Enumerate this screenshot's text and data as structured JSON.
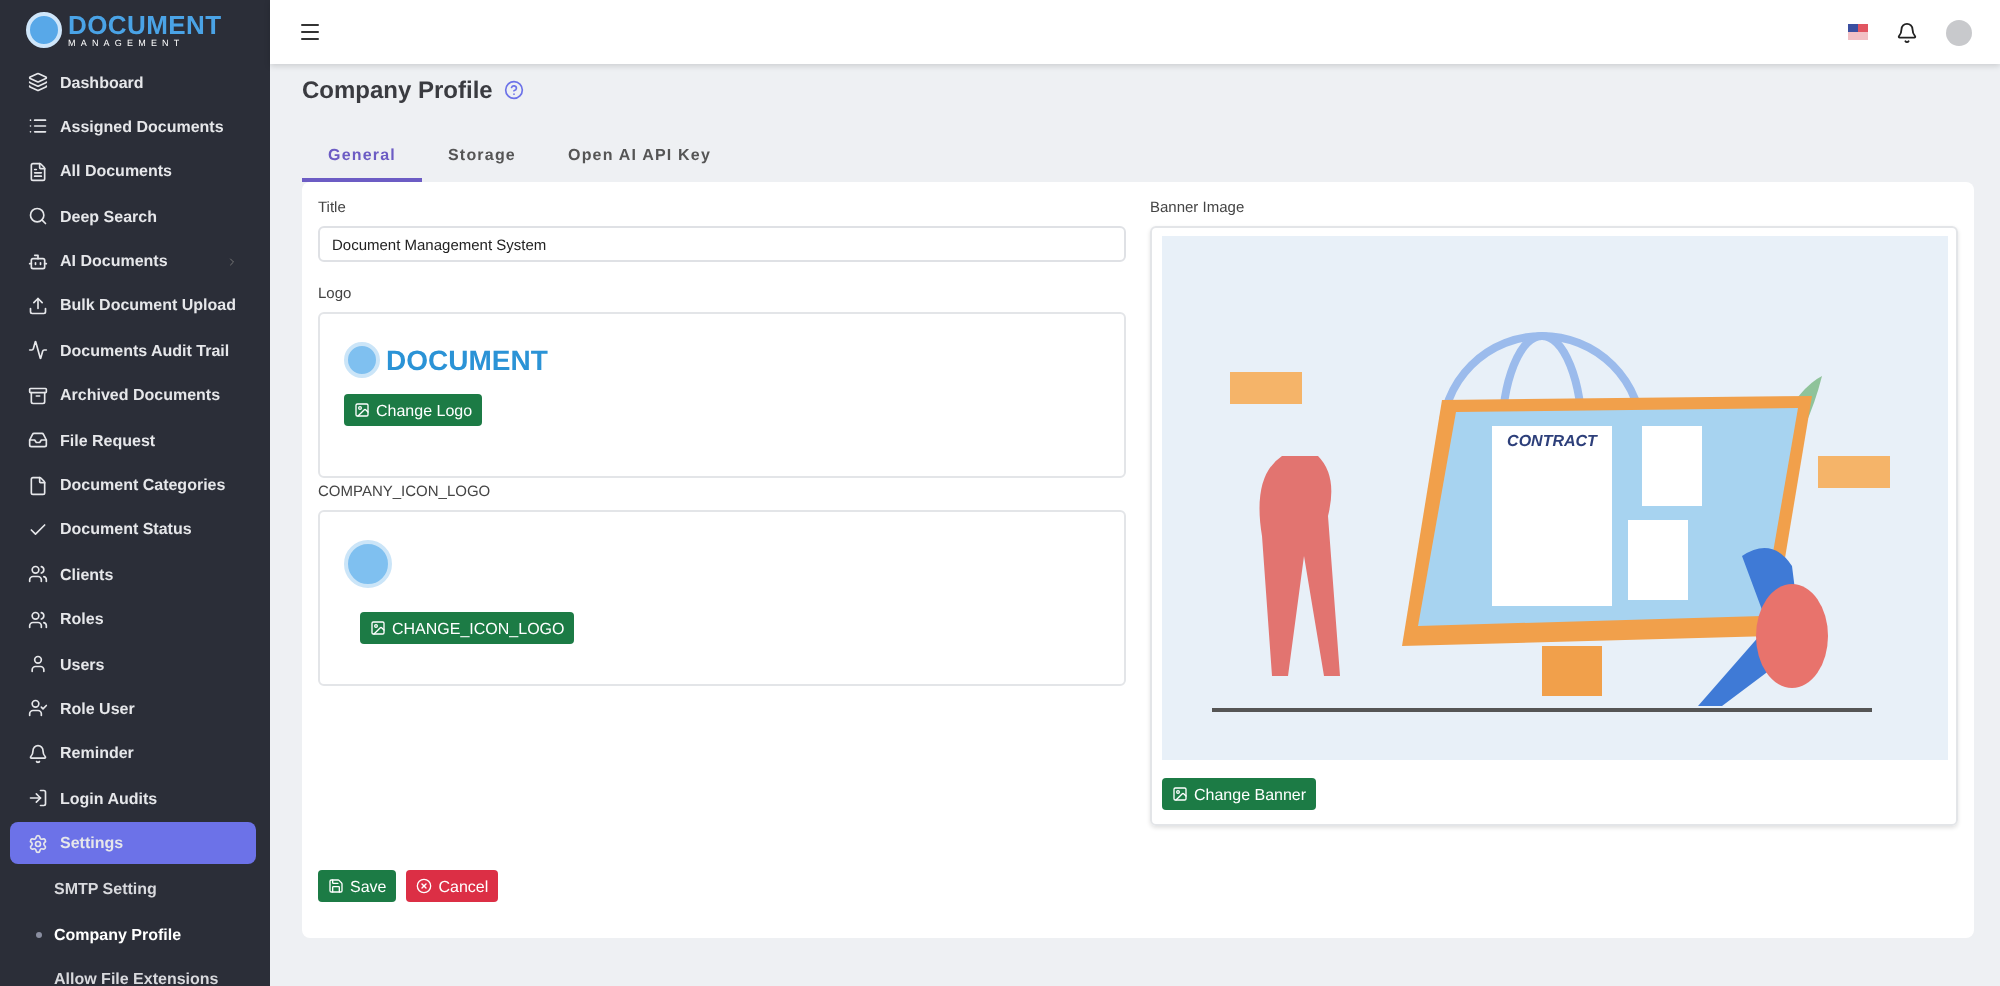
{
  "sidebar": {
    "logo": {
      "title": "DOCUMENT",
      "subtitle": "MANAGEMENT"
    },
    "items": [
      {
        "label": "Dashboard",
        "selected": false
      },
      {
        "label": "Assigned Documents",
        "selected": false
      },
      {
        "label": "All Documents",
        "selected": false
      },
      {
        "label": "Deep Search",
        "selected": false
      },
      {
        "label": "AI Documents",
        "selected": false,
        "expandable": true
      },
      {
        "label": "Bulk Document Upload",
        "selected": false
      },
      {
        "label": "Documents Audit Trail",
        "selected": false
      },
      {
        "label": "Archived Documents",
        "selected": false
      },
      {
        "label": "File Request",
        "selected": false
      },
      {
        "label": "Document Categories",
        "selected": false
      },
      {
        "label": "Document Status",
        "selected": false
      },
      {
        "label": "Clients",
        "selected": false
      },
      {
        "label": "Roles",
        "selected": false
      },
      {
        "label": "Users",
        "selected": false
      },
      {
        "label": "Role User",
        "selected": false
      },
      {
        "label": "Reminder",
        "selected": false
      },
      {
        "label": "Login Audits",
        "selected": false
      },
      {
        "label": "Settings",
        "selected": true,
        "children": [
          {
            "label": "SMTP Setting",
            "selected": false
          },
          {
            "label": "Company Profile",
            "selected": true
          },
          {
            "label": "Allow File Extensions",
            "selected": false
          }
        ]
      }
    ]
  },
  "page": {
    "title": "Company Profile"
  },
  "tabs": [
    {
      "label": "General",
      "selected": true
    },
    {
      "label": "Storage",
      "selected": false
    },
    {
      "label": "Open AI API Key",
      "selected": false
    }
  ],
  "form": {
    "title_label": "Title",
    "title_value": "Document Management System",
    "logo_label": "Logo",
    "logo_text": "DOCUMENT",
    "change_logo": "Change Logo",
    "icon_label": "COMPANY_ICON_LOGO",
    "change_icon": "CHANGE_ICON_LOGO",
    "banner_label": "Banner Image",
    "banner_text": "CONTRACT",
    "change_banner": "Change Banner",
    "save": "Save",
    "cancel": "Cancel"
  }
}
